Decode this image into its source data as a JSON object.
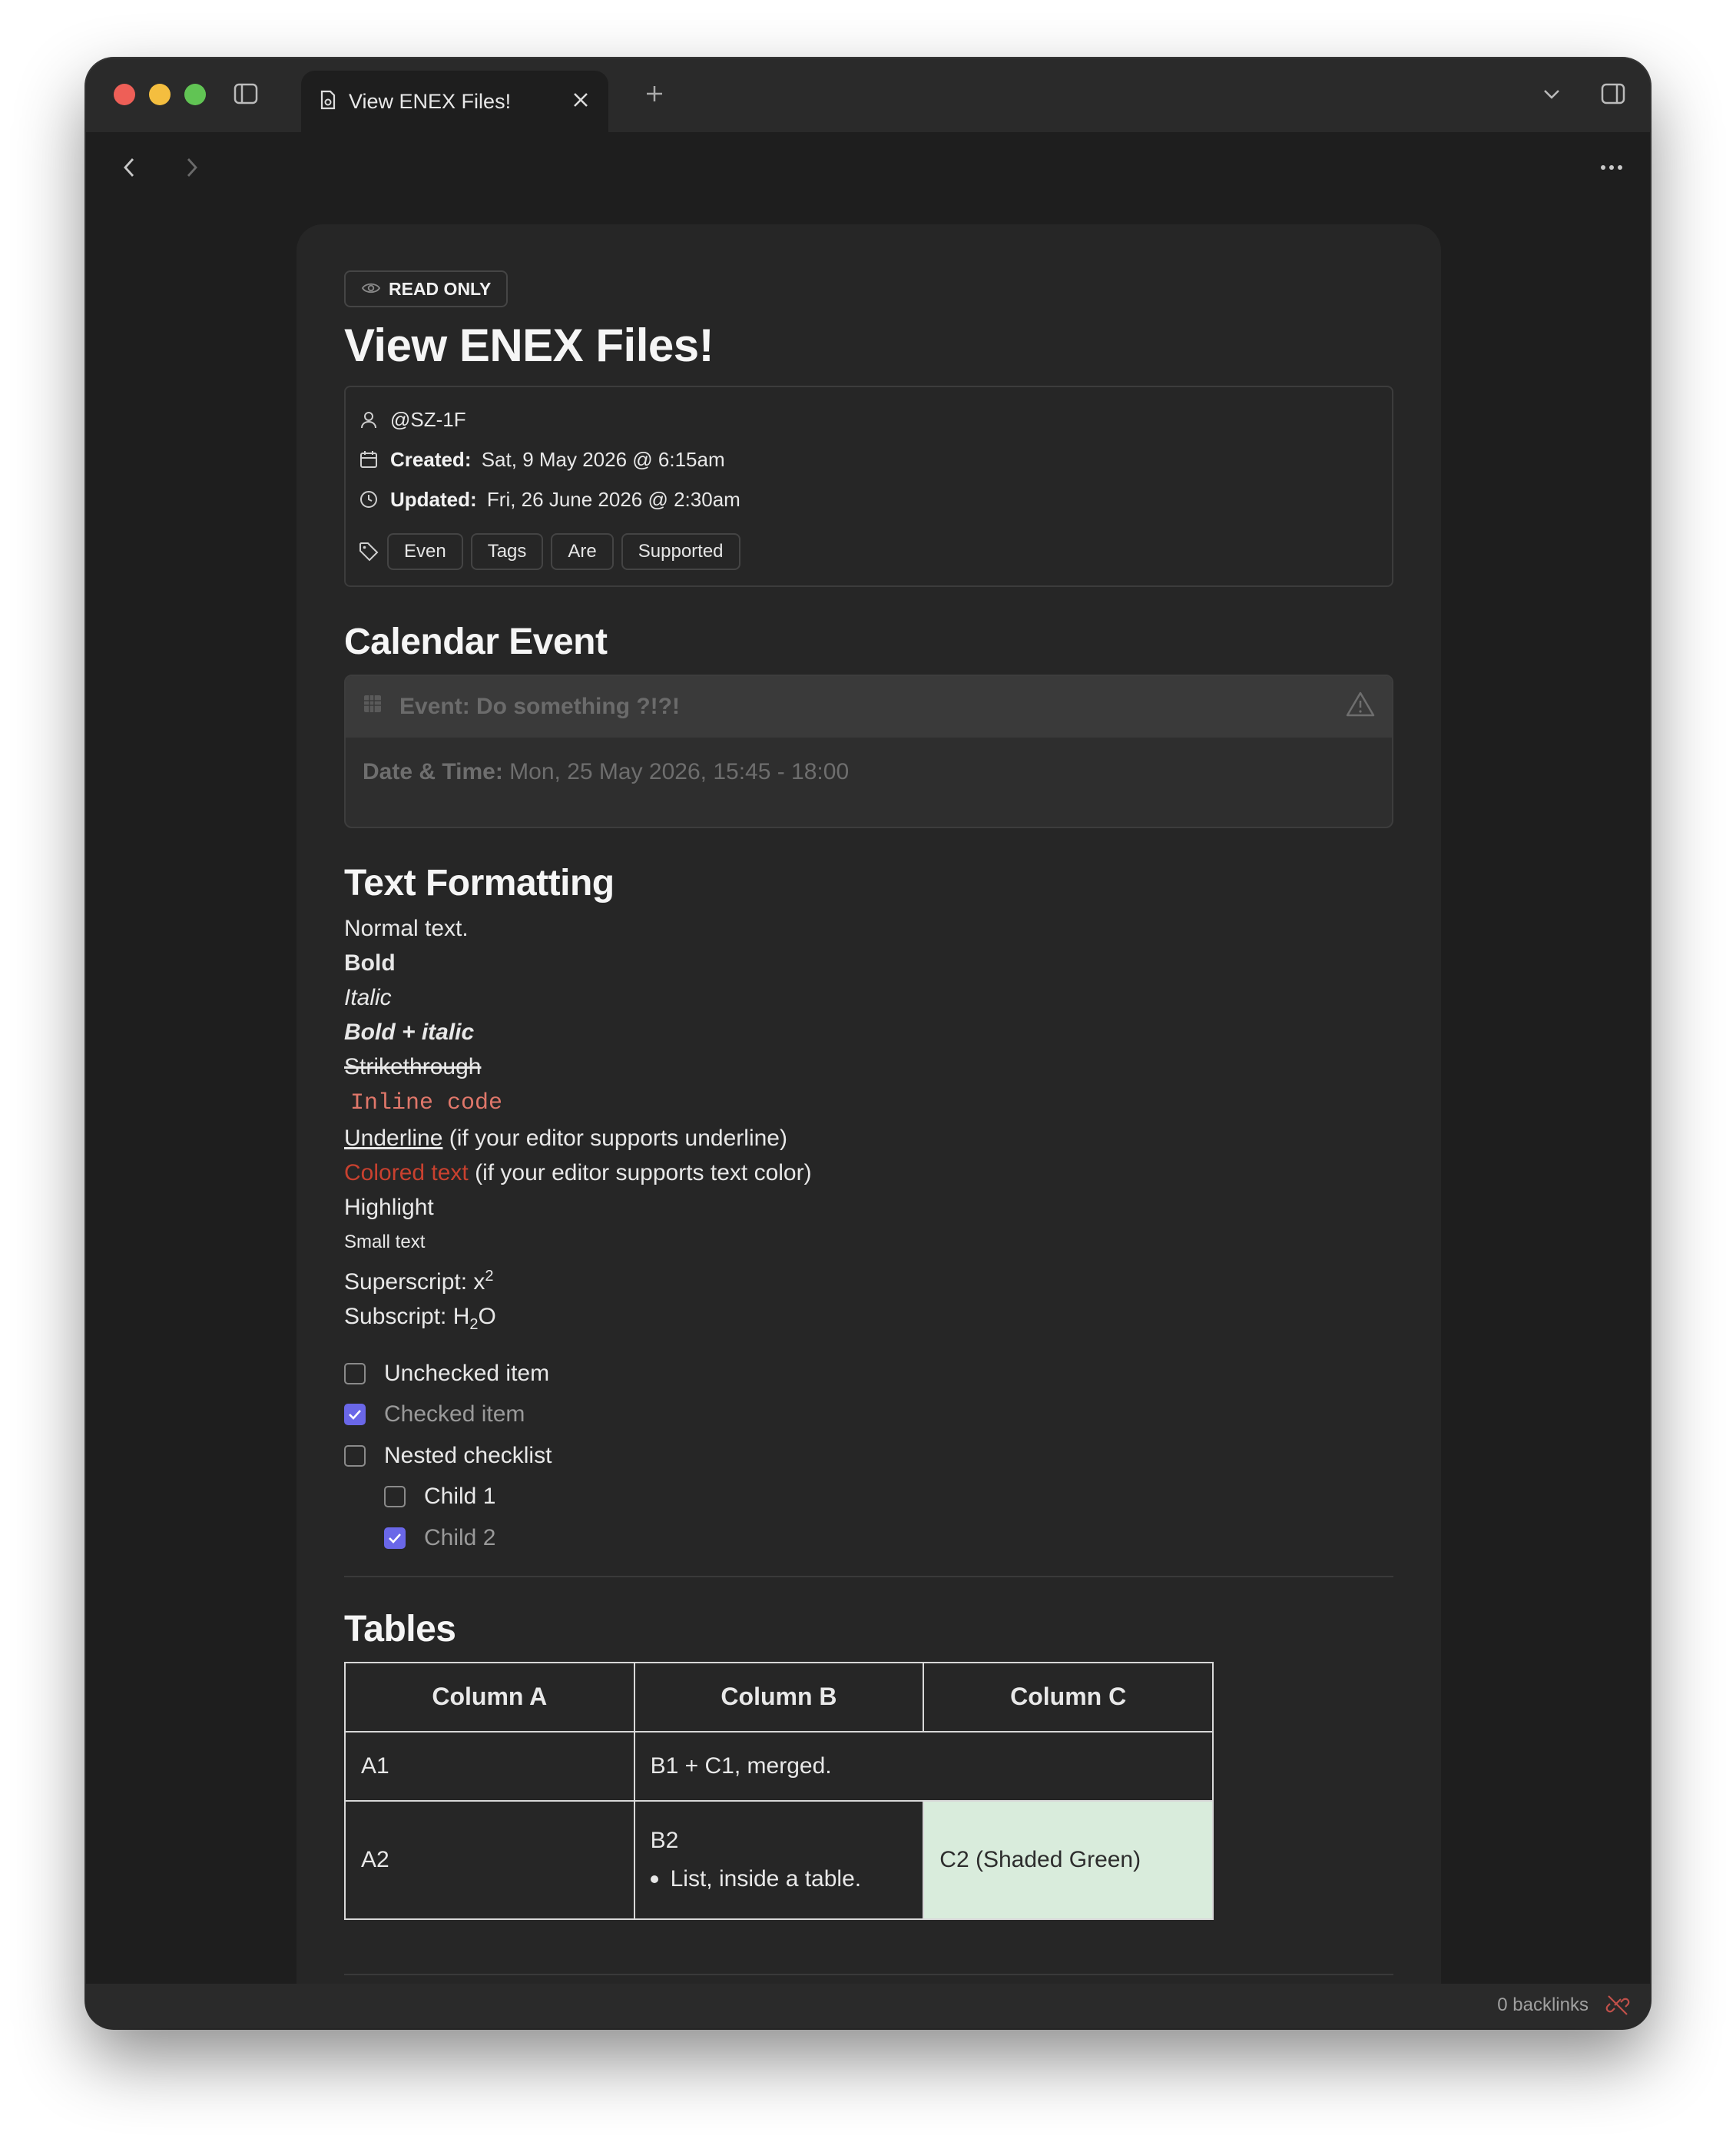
{
  "window": {
    "tab_title": "View ENEX Files!"
  },
  "note": {
    "badge": "READ ONLY",
    "title": "View ENEX Files!",
    "meta": {
      "author": "@SZ-1F",
      "created_label": "Created:",
      "created_value": "Sat, 9 May 2026 @ 6:15am",
      "updated_label": "Updated:",
      "updated_value": "Fri, 26 June 2026 @ 2:30am",
      "tags": [
        "Even",
        "Tags",
        "Are",
        "Supported"
      ]
    },
    "calendar": {
      "heading": "Calendar Event",
      "event_title": "Event: Do something ?!?!",
      "datetime_label": "Date & Time:",
      "datetime_value": "Mon, 25 May 2026, 15:45 - 18:00"
    },
    "formatting": {
      "heading": "Text Formatting",
      "normal": "Normal text.",
      "bold": "Bold",
      "italic": "Italic",
      "bold_italic": "Bold + italic",
      "strike": "Strikethrough",
      "code": "Inline code",
      "underline": "Underline",
      "underline_note": " (if your editor supports underline)",
      "colored": "Colored text",
      "colored_note": " (if your editor supports text color)",
      "highlight": "Highlight",
      "small": "Small text",
      "superscript_label": "Superscript: x",
      "superscript_value": "2",
      "subscript_label": "Subscript: H",
      "subscript_value": "2",
      "subscript_tail": "O"
    },
    "checklist": [
      {
        "label": "Unchecked item",
        "checked": false
      },
      {
        "label": "Checked item",
        "checked": true
      },
      {
        "label": "Nested checklist",
        "checked": false
      },
      {
        "label": "Child 1",
        "checked": false
      },
      {
        "label": "Child 2",
        "checked": true
      }
    ],
    "tables": {
      "heading": "Tables",
      "headers": [
        "Column A",
        "Column B",
        "Column C"
      ],
      "a1": "A1",
      "b1c1": "B1 + C1, merged.",
      "a2": "A2",
      "b2": "B2",
      "b2_list": "List, inside a table.",
      "c2": "C2 (Shaded Green)",
      "c2_color": "#d9ecdc"
    }
  },
  "statusbar": {
    "backlinks": "0 backlinks"
  },
  "colors": {
    "accent_check": "#6a67e8",
    "colored_text": "#c9412f",
    "code_text": "#e0776a"
  }
}
